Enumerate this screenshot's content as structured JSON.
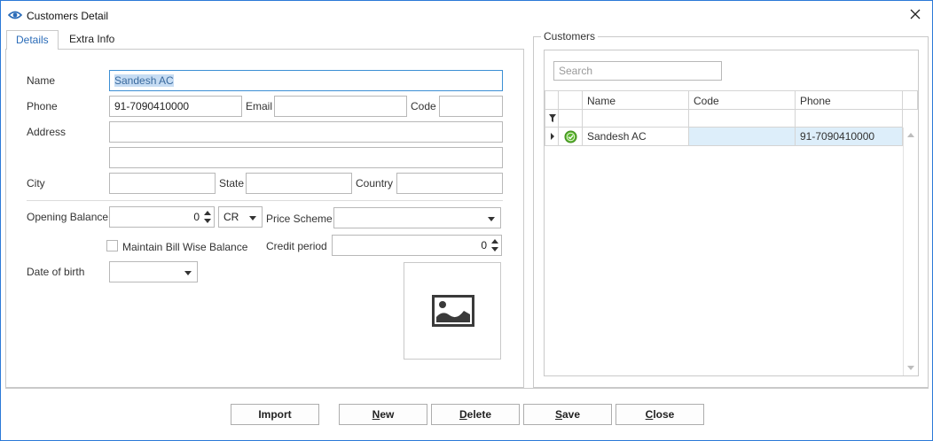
{
  "window": {
    "title": "Customers Detail"
  },
  "tabs": [
    {
      "label": "Details",
      "active": true
    },
    {
      "label": "Extra Info",
      "active": false
    }
  ],
  "form": {
    "name_label": "Name",
    "name_value": "Sandesh AC",
    "phone_label": "Phone",
    "phone_value": "91-7090410000",
    "email_label": "Email",
    "email_value": "",
    "code_label": "Code",
    "code_value": "",
    "address_label": "Address",
    "address_line1": "",
    "address_line2": "",
    "city_label": "City",
    "city_value": "",
    "state_label": "State",
    "state_value": "",
    "country_label": "Country",
    "country_value": "",
    "opening_balance_label": "Opening Balance",
    "opening_balance_value": "0",
    "drcr_value": "CR",
    "price_scheme_label": "Price Scheme",
    "price_scheme_value": "",
    "maintain_bill_wise_label": "Maintain Bill Wise Balance",
    "maintain_bill_wise_checked": false,
    "credit_period_label": "Credit period",
    "credit_period_value": "0",
    "dob_label": "Date of birth",
    "dob_value": ""
  },
  "customers": {
    "group_title": "Customers",
    "search_placeholder": "Search",
    "columns": [
      "Name",
      "Code",
      "Phone"
    ],
    "rows": [
      {
        "name": "Sandesh AC",
        "code": "",
        "phone": "91-7090410000"
      }
    ]
  },
  "buttons": {
    "import": "Import",
    "new_first": "N",
    "new_rest": "ew",
    "delete_first": "D",
    "delete_rest": "elete",
    "save_first": "S",
    "save_rest": "ave",
    "close_first": "C",
    "close_rest": "lose"
  },
  "colors": {
    "accent": "#2b79d7",
    "selection": "#ddeefa",
    "status_ok": "#5bb52f"
  },
  "icons": {
    "app": "eye-icon",
    "close": "close-icon",
    "photo": "image-placeholder-icon",
    "filter": "filter-icon",
    "status": "check-circle-icon"
  }
}
